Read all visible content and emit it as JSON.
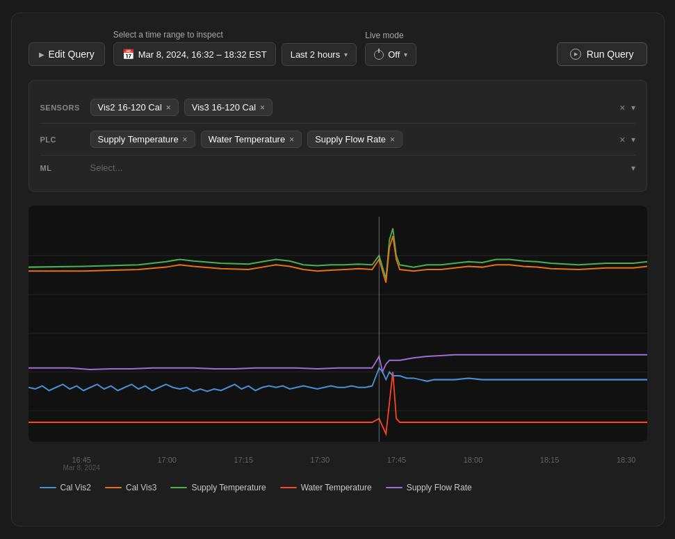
{
  "toolbar": {
    "edit_query_label": "Edit Query",
    "time_range_label": "Select a time range to inspect",
    "time_display": "Mar 8, 2024, 16:32 – 18:32 EST",
    "last_hours": "Last 2 hours",
    "live_mode_label": "Live mode",
    "live_mode_off": "Off",
    "run_query_label": "Run Query"
  },
  "filters": {
    "sensors_label": "SENSORS",
    "sensors_tags": [
      {
        "label": "Vis2 16-120 Cal",
        "id": "vis2"
      },
      {
        "label": "Vis3 16-120 Cal",
        "id": "vis3"
      }
    ],
    "plc_label": "PLC",
    "plc_tags": [
      {
        "label": "Supply Temperature",
        "id": "supply-temp"
      },
      {
        "label": "Water Temperature",
        "id": "water-temp"
      },
      {
        "label": "Supply Flow Rate",
        "id": "flow-rate"
      }
    ],
    "ml_label": "ML",
    "ml_placeholder": "Select..."
  },
  "x_axis": {
    "ticks": [
      {
        "time": "16:45",
        "date": "Mar 8, 2024"
      },
      {
        "time": "17:00",
        "date": ""
      },
      {
        "time": "17:15",
        "date": ""
      },
      {
        "time": "17:30",
        "date": ""
      },
      {
        "time": "17:45",
        "date": ""
      },
      {
        "time": "18:00",
        "date": ""
      },
      {
        "time": "18:15",
        "date": ""
      },
      {
        "time": "18:30",
        "date": ""
      }
    ]
  },
  "legend": {
    "items": [
      {
        "label": "Cal Vis2",
        "color": "#4A90D9"
      },
      {
        "label": "Cal Vis3",
        "color": "#E8720C"
      },
      {
        "label": "Supply Temperature",
        "color": "#4CAF50"
      },
      {
        "label": "Water Temperature",
        "color": "#FF4422"
      },
      {
        "label": "Supply Flow Rate",
        "color": "#9C6FD6"
      }
    ]
  }
}
